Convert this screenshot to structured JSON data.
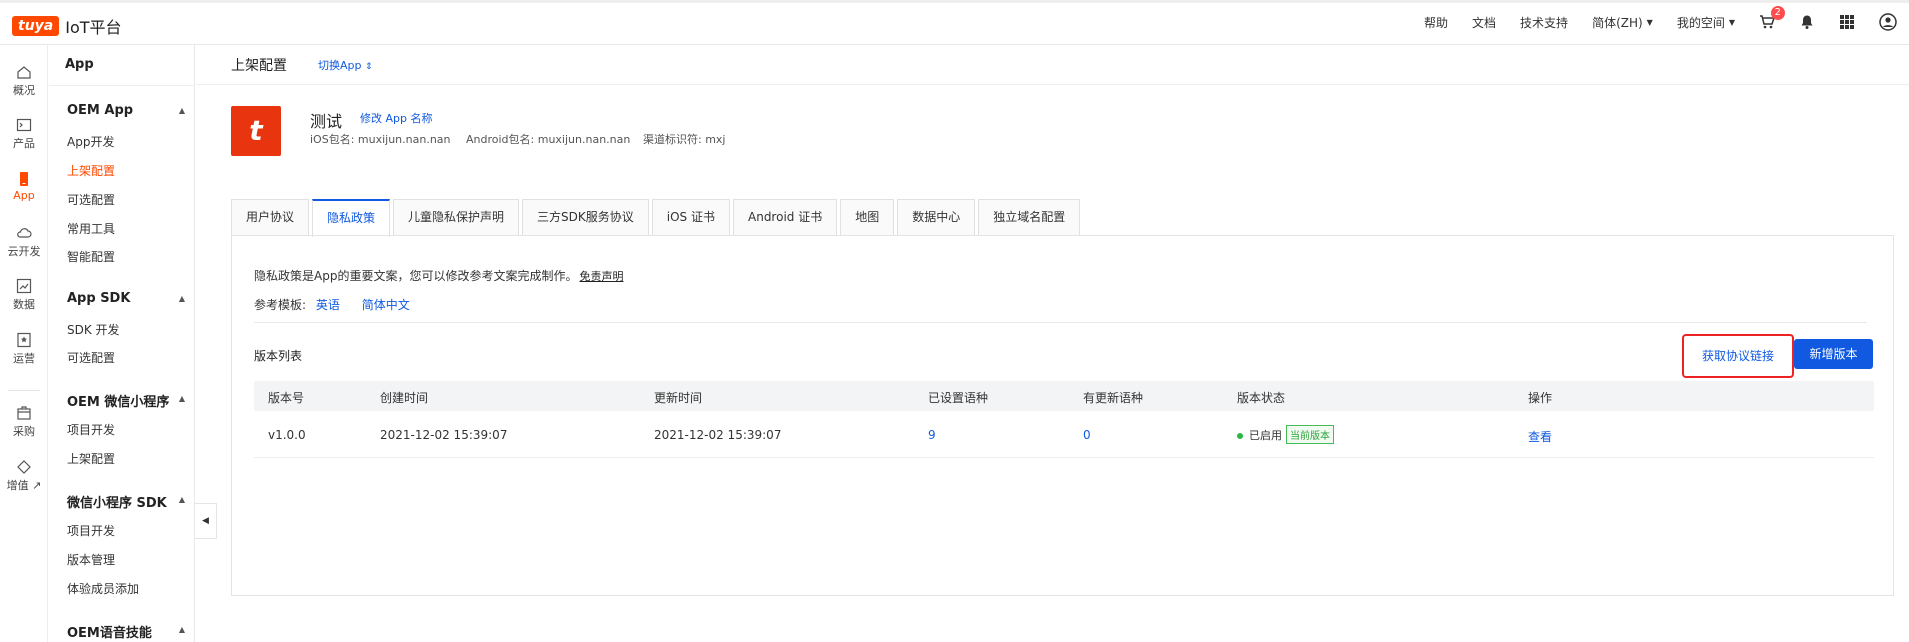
{
  "topbar": {
    "logo_brand": "tuya",
    "logo_text": "IoT平台",
    "nav": [
      "帮助",
      "文档",
      "技术支持"
    ],
    "language": "简体(ZH)",
    "workspace": "我的空间",
    "cart_badge": "2"
  },
  "rail": {
    "items": [
      {
        "label": "概况",
        "icon": "home-icon"
      },
      {
        "label": "产品",
        "icon": "terminal-icon"
      },
      {
        "label": "App",
        "icon": "phone-icon"
      },
      {
        "label": "云开发",
        "icon": "cloud-icon"
      },
      {
        "label": "数据",
        "icon": "chart-icon"
      },
      {
        "label": "运营",
        "icon": "badge-icon"
      },
      {
        "label": "采购",
        "icon": "box-icon"
      },
      {
        "label": "增值 ↗",
        "icon": "diamond-icon"
      }
    ],
    "active": "App"
  },
  "sidebar": {
    "title": "App",
    "groups": [
      {
        "label": "OEM App",
        "items": [
          "App开发",
          "上架配置",
          "可选配置",
          "常用工具",
          "智能配置"
        ]
      },
      {
        "label": "App SDK",
        "items": [
          "SDK 开发",
          "可选配置"
        ]
      },
      {
        "label": "OEM 微信小程序",
        "items": [
          "项目开发",
          "上架配置"
        ]
      },
      {
        "label": "微信小程序 SDK",
        "items": [
          "项目开发",
          "版本管理",
          "体验成员添加"
        ]
      },
      {
        "label": "OEM语音技能",
        "items": []
      }
    ],
    "active_item": "上架配置"
  },
  "header": {
    "title": "上架配置",
    "switch_app": "切换App"
  },
  "app": {
    "icon_letter": "t",
    "name": "测试",
    "rename_link": "修改 App 名称",
    "ios_package": "iOS包名: muxijun.nan.nan",
    "android_package": "Android包名: muxijun.nan.nan",
    "channel_id": "渠道标识符: mxj"
  },
  "tabs": [
    "用户协议",
    "隐私政策",
    "儿童隐私保护声明",
    "三方SDK服务协议",
    "iOS 证书",
    "Android 证书",
    "地图",
    "数据中心",
    "独立域名配置"
  ],
  "active_tab": "隐私政策",
  "panel": {
    "description": "隐私政策是App的重要文案，您可以修改参考文案完成制作。",
    "disclaimer": "免责声明",
    "template_label": "参考模板:",
    "template_en": "英语",
    "template_zh": "简体中文",
    "version_list_title": "版本列表",
    "get_link_button": "获取协议链接",
    "new_version_button": "新增版本"
  },
  "table": {
    "headers": [
      "版本号",
      "创建时间",
      "更新时间",
      "已设置语种",
      "有更新语种",
      "版本状态",
      "操作"
    ],
    "rows": [
      {
        "version": "v1.0.0",
        "created": "2021-12-02 15:39:07",
        "updated": "2021-12-02 15:39:07",
        "set_langs": "9",
        "updated_langs": "0",
        "status": "已启用",
        "current_tag": "当前版本",
        "action": "查看"
      }
    ]
  },
  "colors": {
    "brand": "#ff4800",
    "primary": "#1059e0",
    "highlight_border": "#e22222",
    "status_green": "#2db742"
  }
}
